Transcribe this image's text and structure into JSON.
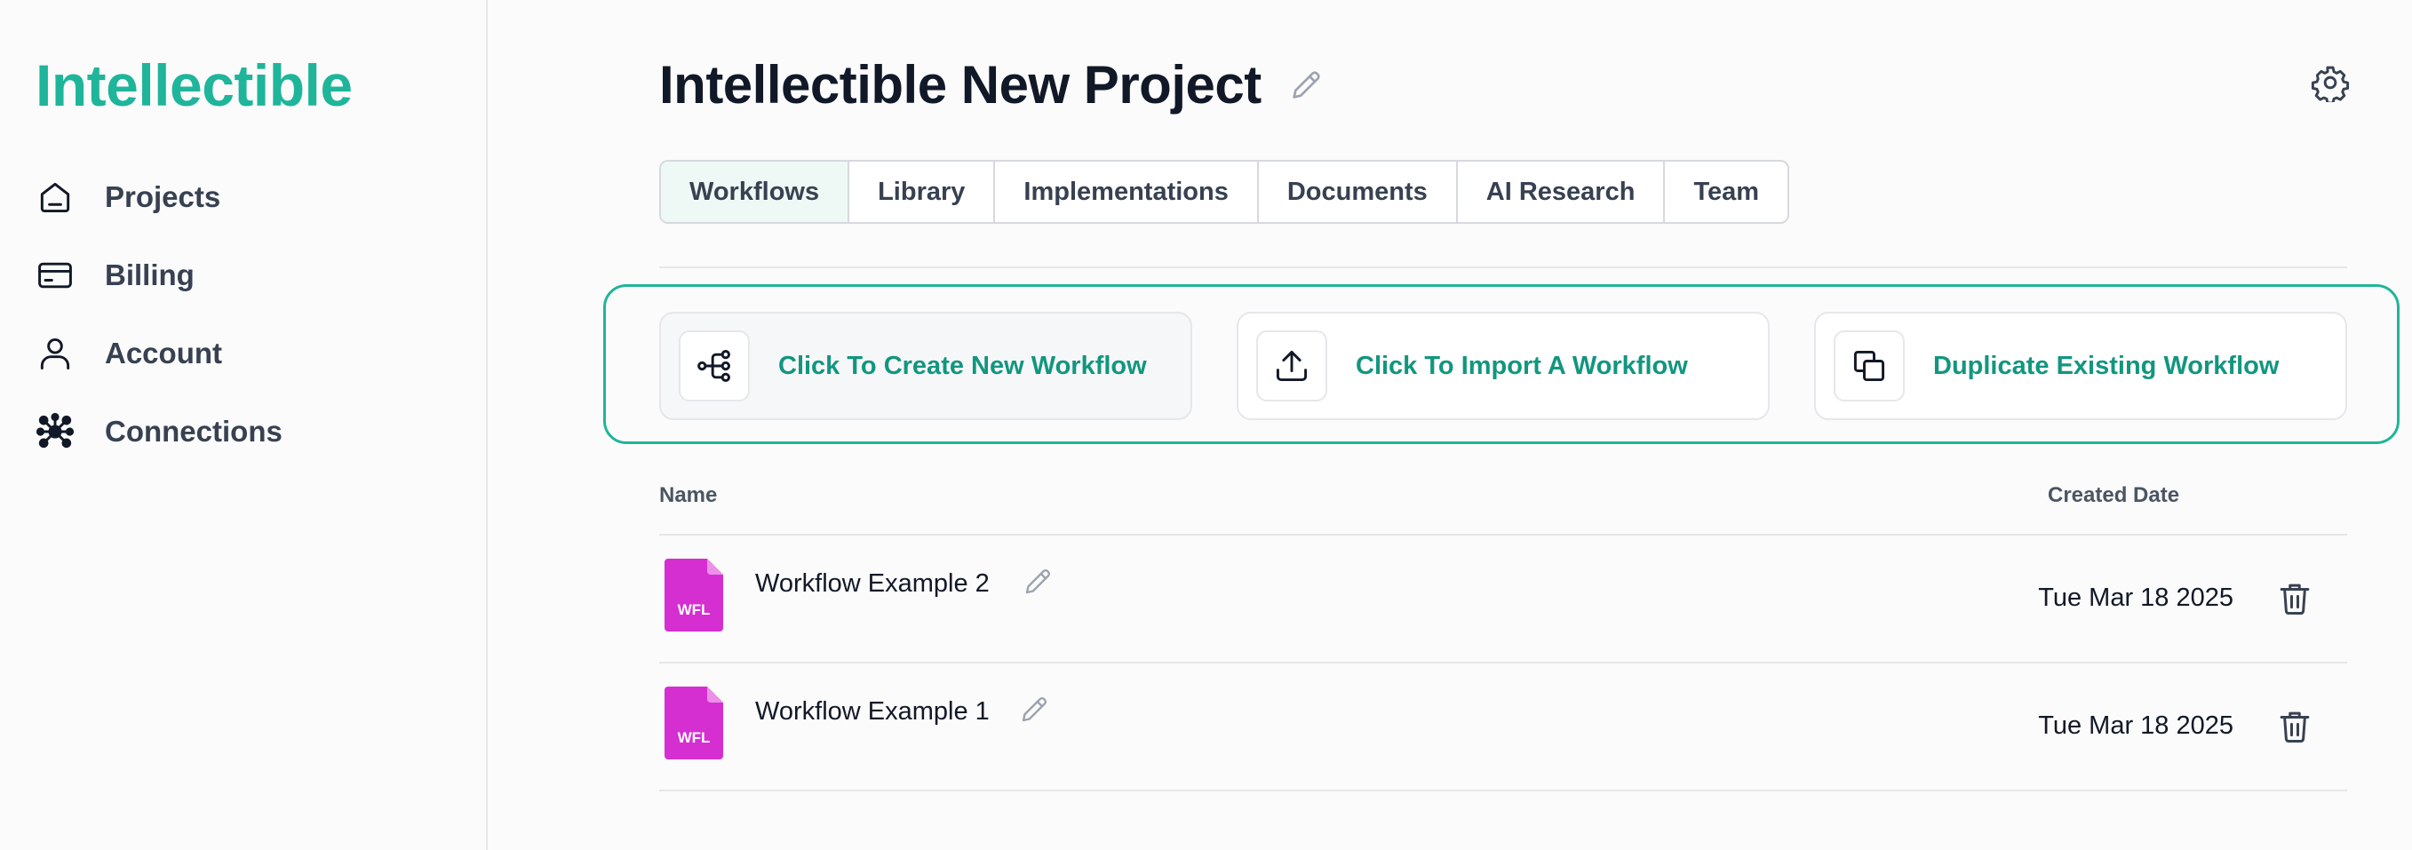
{
  "app": {
    "logo": "Intellectible"
  },
  "sidebar": {
    "items": [
      {
        "label": "Projects",
        "icon": "home-icon"
      },
      {
        "label": "Billing",
        "icon": "credit-card-icon"
      },
      {
        "label": "Account",
        "icon": "user-icon"
      },
      {
        "label": "Connections",
        "icon": "network-icon"
      }
    ]
  },
  "header": {
    "title": "Intellectible New Project"
  },
  "tabs": [
    {
      "label": "Workflows",
      "active": true
    },
    {
      "label": "Library",
      "active": false
    },
    {
      "label": "Implementations",
      "active": false
    },
    {
      "label": "Documents",
      "active": false
    },
    {
      "label": "AI Research",
      "active": false
    },
    {
      "label": "Team",
      "active": false
    }
  ],
  "actions": [
    {
      "label": "Click To Create New Workflow",
      "icon": "workflow-icon"
    },
    {
      "label": "Click To Import A Workflow",
      "icon": "upload-icon"
    },
    {
      "label": "Duplicate Existing Workflow",
      "icon": "copy-icon"
    }
  ],
  "table": {
    "headers": {
      "name": "Name",
      "created": "Created Date"
    },
    "rows": [
      {
        "name": "Workflow Example 2",
        "created": "Tue Mar 18 2025",
        "file_badge": "WFL"
      },
      {
        "name": "Workflow Example 1",
        "created": "Tue Mar 18 2025",
        "file_badge": "WFL"
      }
    ]
  },
  "colors": {
    "brand": "#1fb59a",
    "accent_text": "#12967f",
    "file_icon": "#d62fd1"
  }
}
